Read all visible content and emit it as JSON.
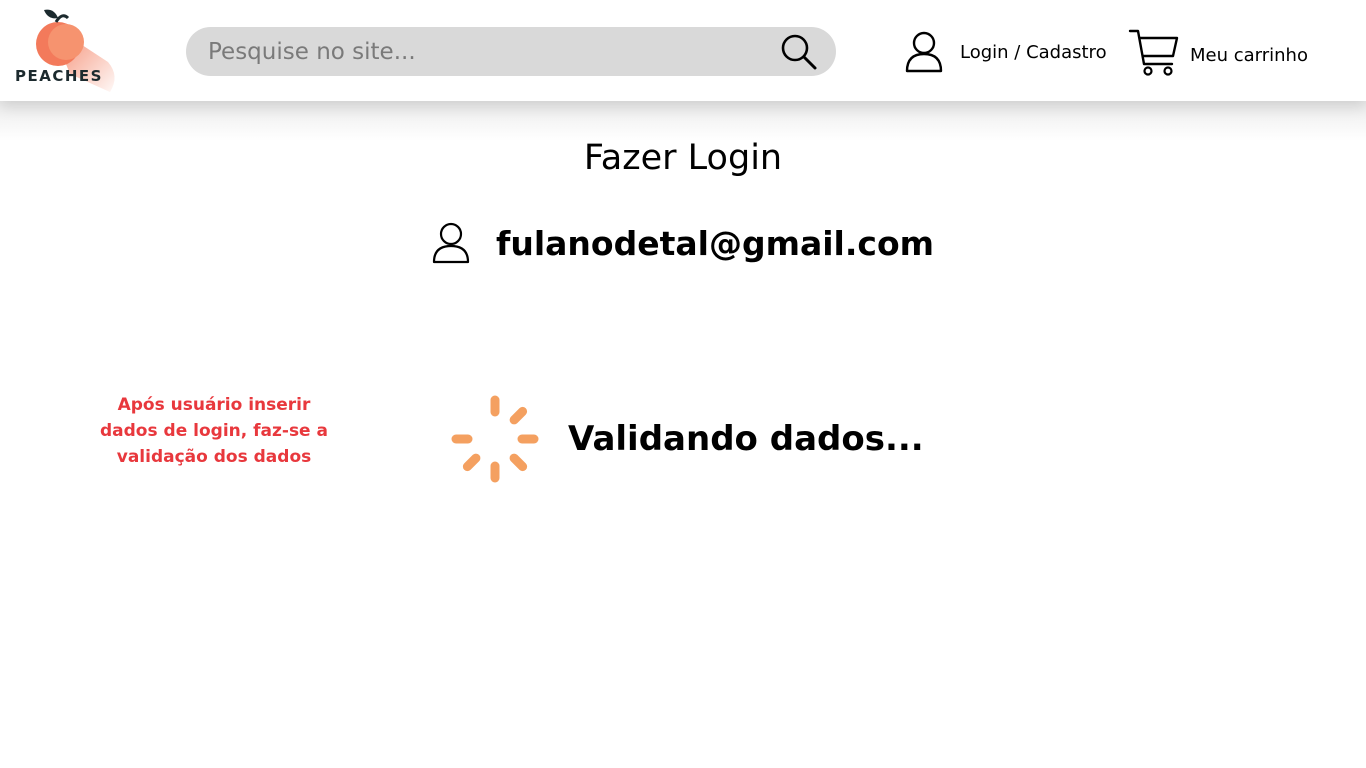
{
  "header": {
    "logo_text": "PEACHES",
    "search": {
      "placeholder": "Pesquise no site...",
      "value": ""
    },
    "login_label": "Login / Cadastro",
    "cart_label": "Meu carrinho"
  },
  "main": {
    "title": "Fazer Login",
    "email": "fulanodetal@gmail.com",
    "loading_text": "Validando dados..."
  },
  "annotation": {
    "lines": [
      "Após usuário inserir",
      "dados de login, faz-se a",
      "validação dos dados"
    ]
  },
  "colors": {
    "accent": "#f4a060",
    "logo_peach": "#f37a5b",
    "annotation": "#e8383d",
    "search_bg": "#d9d9d9"
  },
  "icons": {
    "search": "search-icon",
    "user": "user-icon",
    "cart": "cart-icon",
    "spinner": "spinner-icon"
  }
}
